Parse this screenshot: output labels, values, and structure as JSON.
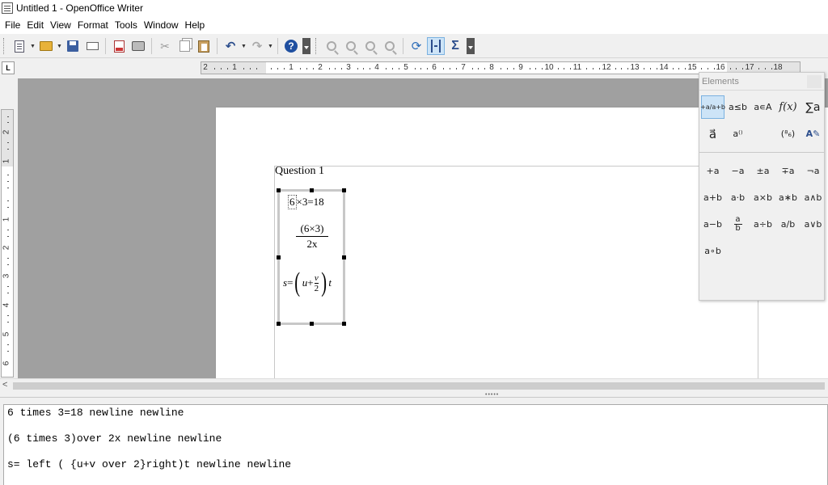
{
  "window": {
    "title": "Untitled 1 - OpenOffice Writer"
  },
  "menu": [
    "File",
    "Edit",
    "View",
    "Format",
    "Tools",
    "Window",
    "Help"
  ],
  "toolbar": {
    "icons": [
      "new-document-icon",
      "open-folder-icon",
      "save-icon",
      "email-icon",
      "export-pdf-icon",
      "print-icon",
      "cut-icon",
      "copy-icon",
      "paste-icon",
      "undo-icon",
      "redo-icon",
      "help-icon",
      "zoom-icon",
      "update-icon",
      "formula-cursor-icon",
      "sigma-icon"
    ],
    "help_glyph": "?",
    "sigma_glyph": "Σ",
    "undo_glyph": "↶",
    "redo_glyph": "↷",
    "update_glyph": "⟳",
    "cut_glyph": "✂"
  },
  "ruler": {
    "corner_glyph": "L",
    "horizontal": [
      "2",
      "1",
      "1",
      "2",
      "3",
      "4",
      "5",
      "6",
      "7",
      "8",
      "9",
      "10",
      "11",
      "12",
      "13",
      "14",
      "15",
      "16",
      "17",
      "18"
    ],
    "vertical": [
      "2",
      "1",
      "1",
      "2",
      "3",
      "4",
      "5",
      "6"
    ]
  },
  "document": {
    "question": "Question 1",
    "formula": {
      "line1_first": "6",
      "line1_rest": "×3=18",
      "frac_num": "(6×3)",
      "frac_den": "2x",
      "line3_s": "s",
      "line3_eq": "=",
      "line3_lparen": "(",
      "line3_u": "u",
      "line3_plus": "+",
      "line3_v": "v",
      "line3_two": "2",
      "line3_rparen": ")",
      "line3_t": "t"
    }
  },
  "elements_panel": {
    "title": "Elements",
    "categories": [
      "+a/a+b",
      "a≤b",
      "a∊A",
      "f(x)",
      "∑a",
      "a⃗",
      "a⁽⁾",
      "",
      "(⁸₆)",
      "A✎"
    ],
    "operators": [
      "+a",
      "−a",
      "±a",
      "∓a",
      "¬a",
      "a+b",
      "a·b",
      "a×b",
      "a∗b",
      "a∧b",
      "a−b",
      "a/b frac",
      "a÷b",
      "a/b",
      "a∨b",
      "a∘b"
    ]
  },
  "scrollbar": {
    "left_arrow": "<"
  },
  "splitter": {
    "dots": "•••••"
  },
  "command": {
    "lines": [
      "6 times 3=18 newline newline",
      "(6 times 3)over 2x newline newline",
      "s= left ( {u+v over 2}right)t newline newline"
    ]
  }
}
